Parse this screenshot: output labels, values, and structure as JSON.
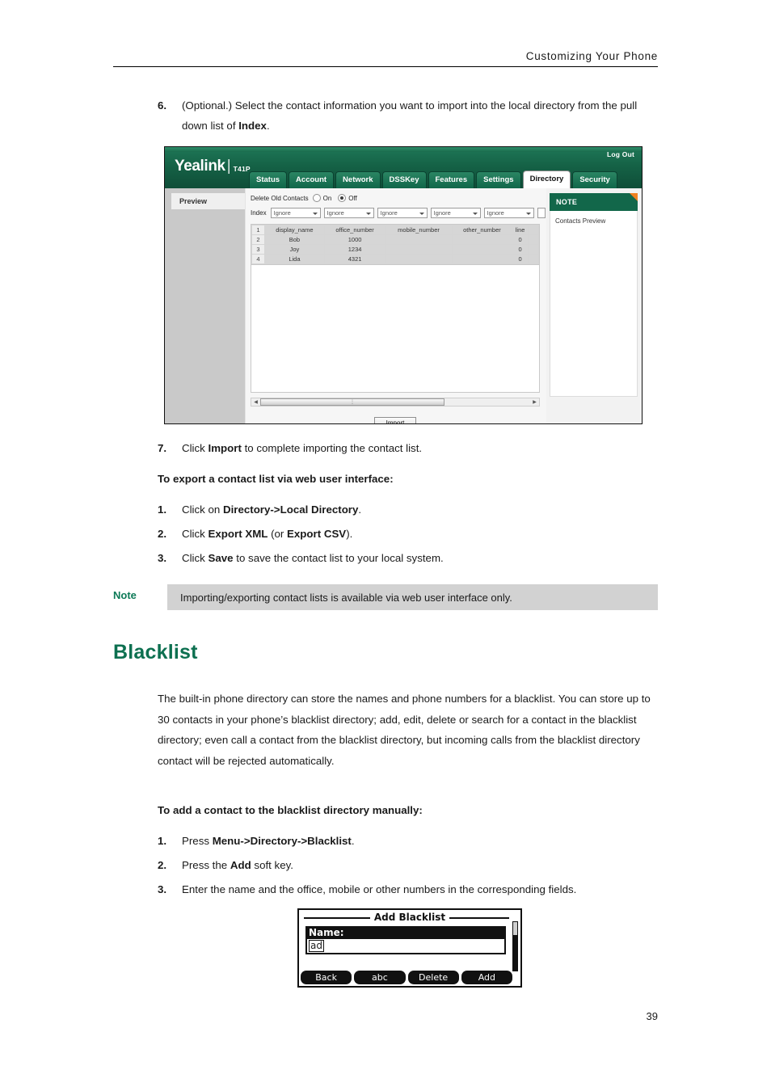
{
  "page": {
    "running_header": "Customizing Your Phone",
    "number": "39"
  },
  "colors": {
    "accent_green": "#0d7050",
    "ui_header_green": "#12674a",
    "note_corner_orange": "#f08020",
    "note_box_grey": "#d2d2d2"
  },
  "steps_import": {
    "step6": {
      "num": "6.",
      "text_before": "(Optional.) Select the contact information you want to import into the local directory from the pull down list of ",
      "bold": "Index",
      "text_after": "."
    },
    "step7": {
      "num": "7.",
      "text_before": "Click ",
      "bold": "Import",
      "text_after": " to complete importing the contact list."
    }
  },
  "webui": {
    "logout_label": "Log Out",
    "brand_name": "Yealink",
    "brand_separator": "|",
    "brand_model": "T41P",
    "tabs": [
      {
        "label": "Status",
        "active": false
      },
      {
        "label": "Account",
        "active": false
      },
      {
        "label": "Network",
        "active": false
      },
      {
        "label": "DSSKey",
        "active": false
      },
      {
        "label": "Features",
        "active": false
      },
      {
        "label": "Settings",
        "active": false
      },
      {
        "label": "Directory",
        "active": true
      },
      {
        "label": "Security",
        "active": false
      }
    ],
    "sidebar": {
      "items": [
        "Preview"
      ]
    },
    "form": {
      "delete_old_contacts_label": "Delete Old Contacts",
      "radio_on_label": "On",
      "radio_off_label": "Off",
      "radio_selected": "Off",
      "index_label": "Index",
      "index_values": [
        "Ignore",
        "Ignore",
        "Ignore",
        "Ignore",
        "Ignore"
      ]
    },
    "preview_table": {
      "row_numbers": [
        "1",
        "2",
        "3",
        "4"
      ],
      "headers": [
        "display_name",
        "office_number",
        "mobile_number",
        "other_number",
        "line"
      ],
      "rows": [
        [
          "Bob",
          "1000",
          "",
          "",
          "0"
        ],
        [
          "Joy",
          "1234",
          "",
          "",
          "0"
        ],
        [
          "Lida",
          "4321",
          "",
          "",
          "0"
        ]
      ]
    },
    "import_button": "Import",
    "note_panel": {
      "title": "NOTE",
      "text": "Contacts Preview"
    }
  },
  "export_section": {
    "heading": "To export a contact list via web user interface:",
    "steps": [
      {
        "num": "1.",
        "text_before": "Click on ",
        "bold": "Directory->Local Directory",
        "text_after": "."
      },
      {
        "num": "2.",
        "text_before": "Click ",
        "bold": "Export XML",
        "text_mid": " (or ",
        "bold2": "Export CSV",
        "text_after": ")."
      },
      {
        "num": "3.",
        "text_before": "Click ",
        "bold": "Save",
        "text_after": " to save the contact list to your local system."
      }
    ]
  },
  "note_callout": {
    "label": "Note",
    "text": "Importing/exporting contact lists is available via web user interface only."
  },
  "blacklist": {
    "heading": "Blacklist",
    "paragraph": "The built-in phone directory can store the names and phone numbers for a blacklist. You can store up to 30 contacts in your phone’s blacklist directory; add, edit, delete or search for a contact in the blacklist directory; even call a contact from the blacklist directory, but incoming calls from the blacklist directory contact will be rejected automatically.",
    "subheading": "To add a contact to the blacklist directory manually:",
    "steps": [
      {
        "num": "1.",
        "text_before": "Press ",
        "bold": "Menu->Directory->Blacklist",
        "text_after": "."
      },
      {
        "num": "2.",
        "text_before": "Press the ",
        "bold": "Add",
        "text_after": " soft key."
      },
      {
        "num": "3.",
        "text_before": "Enter the name and the office, mobile or other numbers in the corresponding fields.",
        "bold": "",
        "text_after": ""
      }
    ]
  },
  "lcd": {
    "title": "Add Blacklist",
    "field_label": "Name:",
    "field_value": "ad",
    "softkeys": [
      "Back",
      "abc",
      "Delete",
      "Add"
    ]
  }
}
